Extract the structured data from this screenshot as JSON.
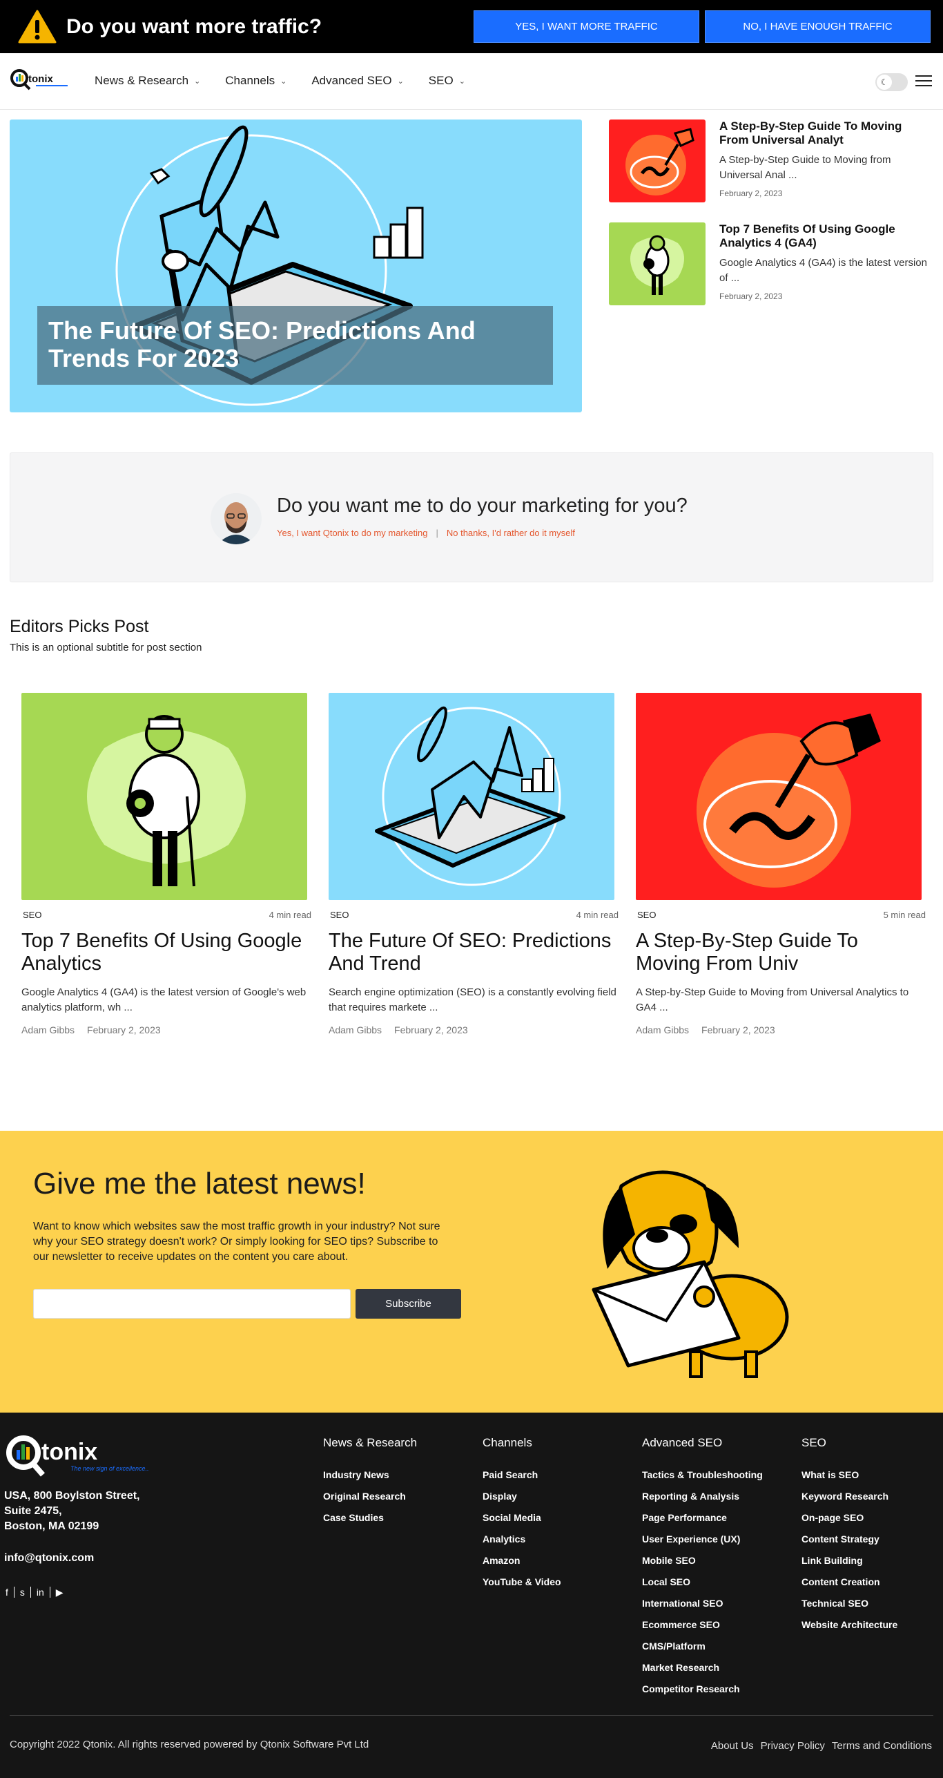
{
  "topbar": {
    "title": "Do you want more traffic?",
    "yes_label": "YES, I WANT MORE TRAFFIC",
    "no_label": "NO, I HAVE ENOUGH TRAFFIC",
    "icon": "warning-icon"
  },
  "header": {
    "logo_text": "tonix",
    "nav": [
      {
        "label": "News & Research"
      },
      {
        "label": "Channels"
      },
      {
        "label": "Advanced SEO"
      },
      {
        "label": "SEO"
      }
    ]
  },
  "hero": {
    "title": "The Future Of SEO: Predictions And Trends For 2023"
  },
  "side_posts": [
    {
      "title": "A Step-By-Step Guide To Moving From Universal Analyt",
      "excerpt": "A Step-by-Step Guide to Moving from Universal Anal ...",
      "date": "February 2, 2023"
    },
    {
      "title": "Top 7 Benefits Of Using Google Analytics 4 (GA4)",
      "excerpt": "Google Analytics 4 (GA4) is the latest version of ...",
      "date": "February 2, 2023"
    }
  ],
  "cta": {
    "question": "Do you want me to do your marketing for you?",
    "yes_link": "Yes, I want Qtonix to do my marketing",
    "no_link": "No thanks, I'd rather do it myself"
  },
  "editors": {
    "title": "Editors Picks Post",
    "subtitle": "This is an optional subtitle for post section",
    "cards": [
      {
        "category": "SEO",
        "read_time": "4 min read",
        "title": "Top 7 Benefits Of Using Google Analytics",
        "excerpt": "Google Analytics 4 (GA4) is the latest version of Google's web analytics platform, wh ...",
        "author": "Adam Gibbs",
        "date": "February 2, 2023"
      },
      {
        "category": "SEO",
        "read_time": "4 min read",
        "title": "The Future Of SEO: Predictions And Trend",
        "excerpt": "Search engine optimization (SEO) is a constantly evolving field that requires markete ...",
        "author": "Adam Gibbs",
        "date": "February 2, 2023"
      },
      {
        "category": "SEO",
        "read_time": "5 min read",
        "title": "A Step-By-Step Guide To Moving From Univ",
        "excerpt": "A Step-by-Step Guide to Moving from Universal Analytics to GA4 ...",
        "author": "Adam Gibbs",
        "date": "February 2, 2023"
      }
    ]
  },
  "newsletter": {
    "title": "Give me the latest news!",
    "text": "Want to know which websites saw the most traffic growth in your industry? Not sure why your SEO strategy doesn't work? Or simply looking for SEO tips? Subscribe to our newsletter to receive updates on the content you care about.",
    "input_value": "",
    "button": "Subscribe"
  },
  "footer": {
    "logo_text": "tonix",
    "logo_tagline": "The new sign of excellence..",
    "address_lines": [
      "USA, 800 Boylston Street,",
      "Suite 2475,",
      "Boston, MA 02199"
    ],
    "email": "info@qtonix.com",
    "social": [
      "f",
      "s",
      "in",
      "▶"
    ],
    "columns": [
      {
        "title": "News & Research",
        "links": [
          "Industry News",
          "Original Research",
          "Case Studies"
        ]
      },
      {
        "title": "Channels",
        "links": [
          "Paid Search",
          "Display",
          "Social Media",
          "Analytics",
          "Amazon",
          "YouTube & Video"
        ]
      },
      {
        "title": "Advanced SEO",
        "links": [
          "Tactics & Troubleshooting",
          "Reporting & Analysis",
          "Page Performance",
          "User Experience (UX)",
          "Mobile SEO",
          "Local SEO",
          "International SEO",
          "Ecommerce SEO",
          "CMS/Platform",
          "Market Research",
          "Competitor Research"
        ]
      },
      {
        "title": "SEO",
        "links": [
          "What is SEO",
          "Keyword Research",
          "On-page SEO",
          "Content Strategy",
          "Link Building",
          "Content Creation",
          "Technical SEO",
          "Website Architecture"
        ]
      }
    ],
    "copyright": "Copyright 2022 Qtonix. All rights reserved powered by Qtonix Software Pvt Ltd",
    "bottom_links": [
      "About Us",
      "Privacy Policy",
      "Terms and Conditions"
    ]
  },
  "colors": {
    "topbar_bg": "#000000",
    "topbar_button": "#1a6dff",
    "cta_link": "#e4572e",
    "newsletter_bg": "#fdd14e",
    "footer_bg": "#151515"
  }
}
